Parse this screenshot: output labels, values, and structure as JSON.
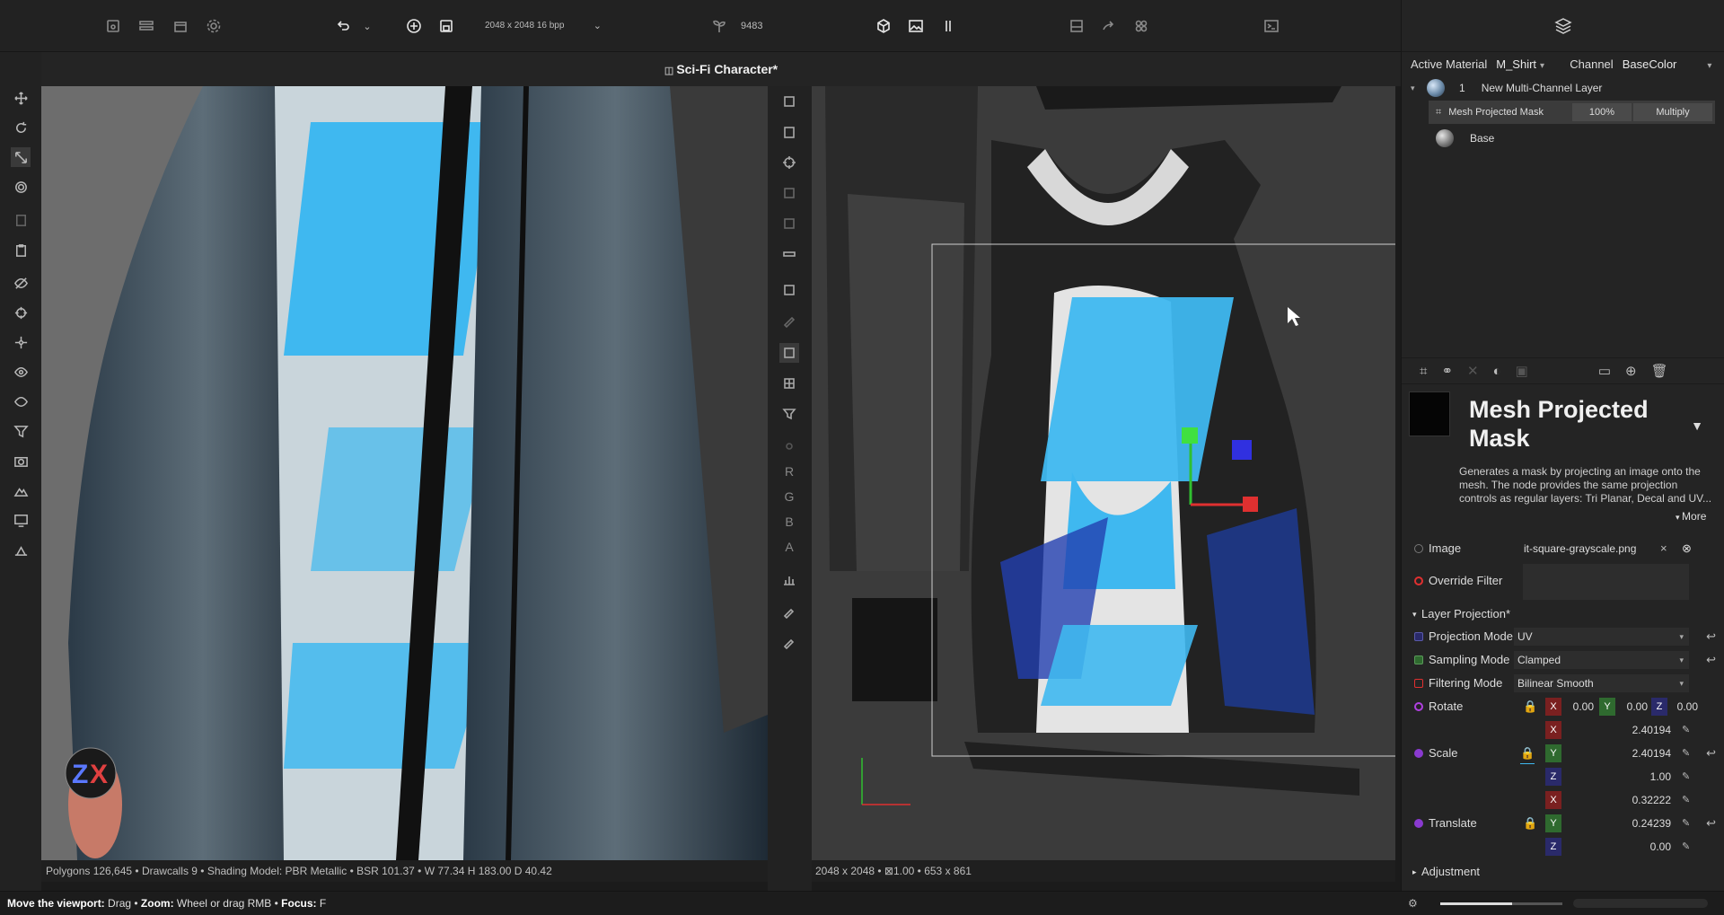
{
  "toolbar": {
    "resolution": "2048 x 2048 16 bpp",
    "count": "9483"
  },
  "document": {
    "title": "Sci-Fi Character*"
  },
  "materials": {
    "active_material_label": "Active Material",
    "active_material_value": "M_Shirt",
    "channel_label": "Channel",
    "channel_value": "BaseColor"
  },
  "layers": {
    "layer1_index": "1",
    "layer1_name": "New Multi-Channel Layer",
    "mask_name": "Mesh Projected Mask",
    "mask_opacity": "100%",
    "mask_blend": "Multiply",
    "base_name": "Base"
  },
  "properties": {
    "title_line1": "Mesh Projected",
    "title_line2": "Mask",
    "description": "Generates a mask by projecting an image onto the mesh. The node provides the same projection controls as regular layers: Tri Planar, Decal and UV...",
    "more_label": "More",
    "image_label": "Image",
    "image_value": "it-square-grayscale.png",
    "override_filter_label": "Override Filter",
    "layer_projection_label": "Layer Projection*",
    "projection_mode_label": "Projection Mode",
    "projection_mode_value": "UV",
    "sampling_mode_label": "Sampling Mode",
    "sampling_mode_value": "Clamped",
    "filtering_mode_label": "Filtering Mode",
    "filtering_mode_value": "Bilinear Smooth",
    "rotate_label": "Rotate",
    "rotate_x": "0.00",
    "rotate_y": "0.00",
    "rotate_z": "0.00",
    "scale_label": "Scale",
    "scale_x": "2.40194",
    "scale_y": "2.40194",
    "scale_z": "1.00",
    "translate_label": "Translate",
    "translate_x": "0.32222",
    "translate_y": "0.24239",
    "translate_z": "0.00",
    "adjustment_label": "Adjustment"
  },
  "status": {
    "viewport3d": "Polygons 126,645 • Drawcalls 9 • Shading Model: PBR Metallic • BSR 101.37 • W 77.34 H 183.00 D 40.42",
    "viewport2d": "2048 x 2048 • ⊠1.00 • 653 x 861"
  },
  "hint": {
    "move_label": "Move the viewport:",
    "move_action": "Drag",
    "zoom_label": "Zoom:",
    "zoom_action": "Wheel or drag RMB",
    "focus_label": "Focus:",
    "focus_action": "F"
  },
  "channel_letters": [
    "R",
    "G",
    "B",
    "A"
  ],
  "colors": {
    "accent_blue": "#3fb8f0",
    "gizmo_red": "#e03030",
    "gizmo_green": "#30c030",
    "gizmo_blue": "#3030e0"
  }
}
